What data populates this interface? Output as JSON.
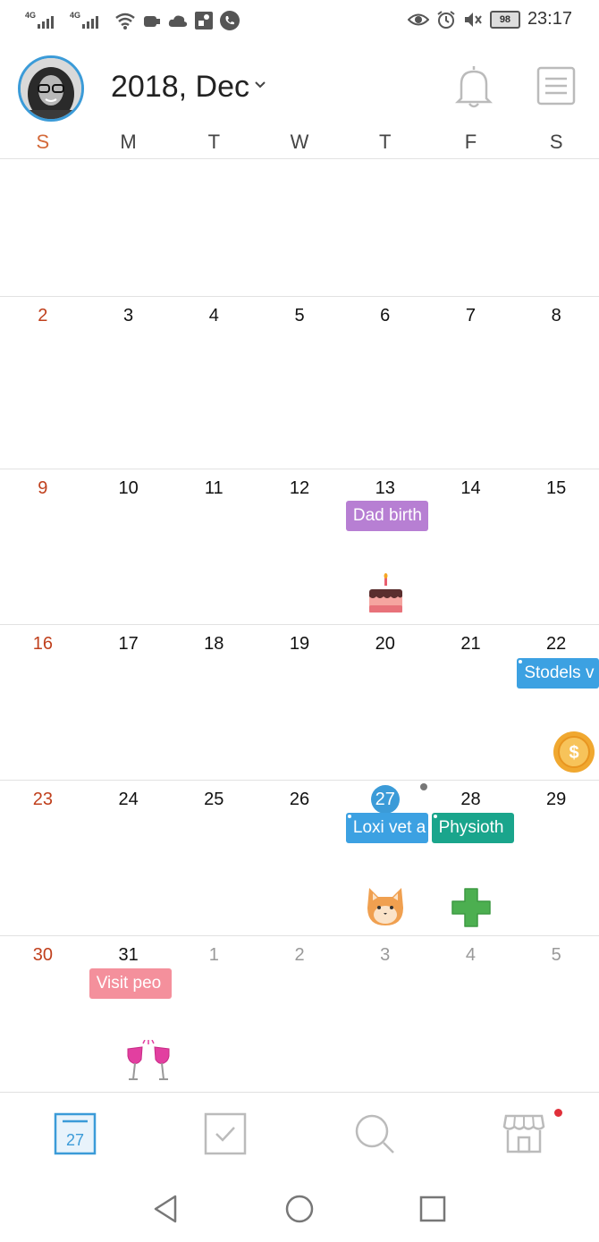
{
  "status": {
    "network_1": "4G",
    "network_2": "4G",
    "battery": "98",
    "time": "23:17",
    "icons": [
      "signal-4g-icon",
      "signal-4g-icon",
      "wifi-icon",
      "app-icon",
      "cloud-icon",
      "app-icon",
      "phone-icon",
      "eye-icon",
      "alarm-icon",
      "mute-icon",
      "battery-icon"
    ]
  },
  "header": {
    "month_label": "2018, Dec",
    "icons": [
      "avatar",
      "chevron-down-icon",
      "bell-icon",
      "menu-list-icon"
    ]
  },
  "weekdays": [
    "S",
    "M",
    "T",
    "W",
    "T",
    "F",
    "S"
  ],
  "weeks": [
    {
      "days": [
        "",
        "",
        "",
        "",
        "",
        "",
        ""
      ]
    },
    {
      "days": [
        "2",
        "3",
        "4",
        "5",
        "6",
        "7",
        "8"
      ]
    },
    {
      "days": [
        "9",
        "10",
        "11",
        "12",
        "13",
        "14",
        "15"
      ]
    },
    {
      "days": [
        "16",
        "17",
        "18",
        "19",
        "20",
        "21",
        "22"
      ]
    },
    {
      "days": [
        "23",
        "24",
        "25",
        "26",
        "27",
        "28",
        "29"
      ]
    },
    {
      "days": [
        "30",
        "31",
        "1",
        "2",
        "3",
        "4",
        "5"
      ]
    }
  ],
  "events": {
    "dad_birthday": "Dad birth",
    "stodels": "Stodels v",
    "loxi_vet": "Loxi vet a",
    "physio": "Physioth",
    "visit_people": "Visit peo"
  },
  "colors": {
    "purple": "#b77fd3",
    "blue": "#3ca1e2",
    "green": "#1aa58c",
    "pink": "#f4909c",
    "accent": "#3b9bd8",
    "sunday": "#c0401d"
  },
  "nav": {
    "calendar_day": "27",
    "icons": [
      "calendar-icon",
      "checkbox-icon",
      "search-icon",
      "store-icon"
    ],
    "system_icons": [
      "back-icon",
      "home-icon",
      "recents-icon"
    ]
  }
}
